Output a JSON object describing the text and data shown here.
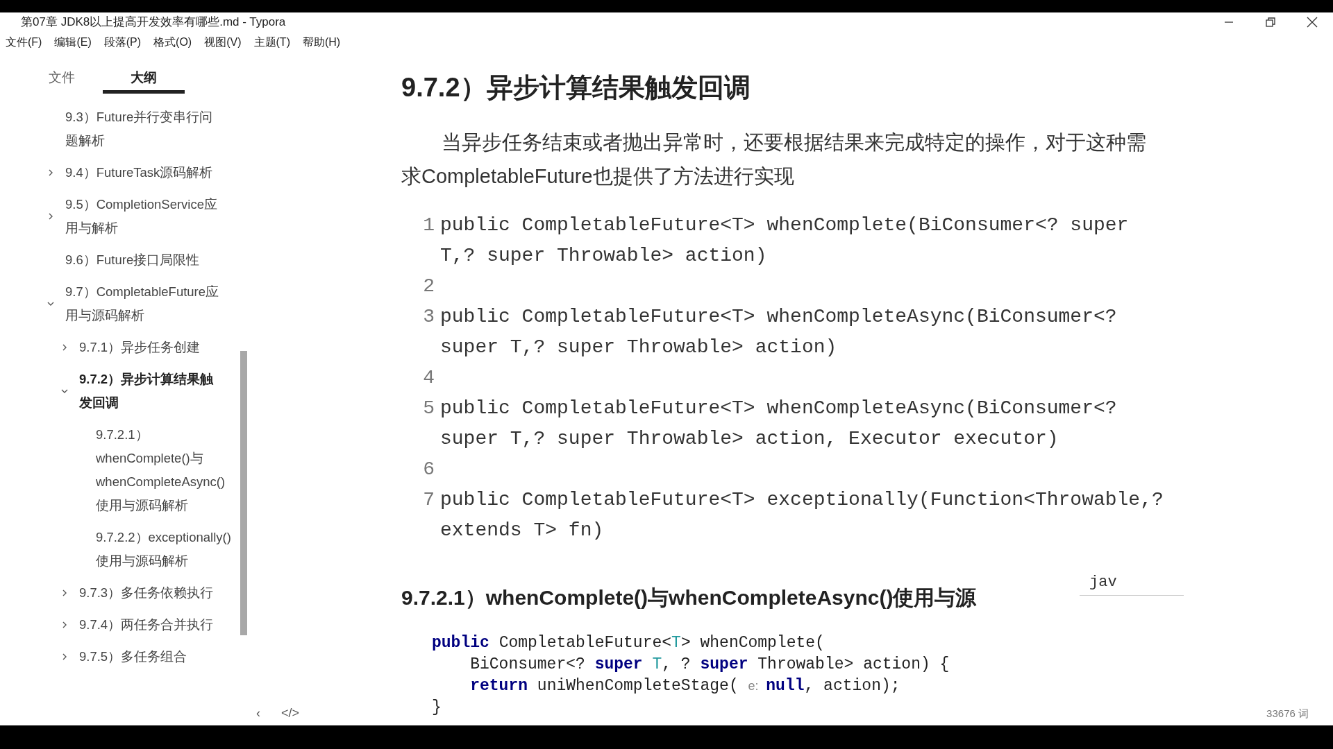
{
  "window": {
    "title": "第07章 JDK8以上提高开发效率有哪些.md - Typora"
  },
  "menu": [
    "文件(F)",
    "编辑(E)",
    "段落(P)",
    "格式(O)",
    "视图(V)",
    "主题(T)",
    "帮助(H)"
  ],
  "sidebar": {
    "tabs": [
      {
        "label": "文件",
        "selected": false
      },
      {
        "label": "大纲",
        "selected": true
      }
    ],
    "outline": [
      {
        "label": "9.3）Future并行变串行问题解析",
        "kind": "leaf",
        "selected": false
      },
      {
        "label": "9.4）FutureTask源码解析",
        "kind": "branch",
        "expanded": false,
        "selected": false
      },
      {
        "label": "9.5）CompletionService应用与解析",
        "kind": "branch",
        "expanded": false,
        "selected": false
      },
      {
        "label": "9.6）Future接口局限性",
        "kind": "leaf",
        "selected": false
      },
      {
        "label": "9.7）CompletableFuture应用与源码解析",
        "kind": "branch",
        "expanded": true,
        "selected": false,
        "children": [
          {
            "label": "9.7.1）异步任务创建",
            "kind": "branch",
            "expanded": false,
            "selected": false
          },
          {
            "label": "9.7.2）异步计算结果触发回调",
            "kind": "branch",
            "expanded": true,
            "selected": true,
            "children": [
              {
                "label": "9.7.2.1）whenComplete()与whenCompleteAsync()使用与源码解析",
                "kind": "leaf",
                "selected": false
              },
              {
                "label": "9.7.2.2）exceptionally()使用与源码解析",
                "kind": "leaf",
                "selected": false
              }
            ]
          },
          {
            "label": "9.7.3）多任务依赖执行",
            "kind": "branch",
            "expanded": false,
            "selected": false
          },
          {
            "label": "9.7.4）两任务合并执行",
            "kind": "branch",
            "expanded": false,
            "selected": false
          },
          {
            "label": "9.7.5）多任务组合",
            "kind": "branch",
            "expanded": false,
            "selected": false
          }
        ]
      }
    ],
    "footer": [
      "‹",
      "</>"
    ]
  },
  "document": {
    "heading": "9.7.2）异步计算结果触发回调",
    "paragraph": "当异步任务结束或者抛出异常时，还要根据结果来完成特定的操作，对于这种需求CompletableFuture也提供了方法进行实现",
    "code_block": [
      {
        "number": "1",
        "text": "public CompletableFuture<T> whenComplete(BiConsumer<? super T,? super Throwable> action)"
      },
      {
        "number": "2"
      },
      {
        "number": "3",
        "text": "public CompletableFuture<T> whenCompleteAsync(BiConsumer<? super T,? super Throwable> action)"
      },
      {
        "number": "4"
      },
      {
        "number": "5",
        "text": "public CompletableFuture<T> whenCompleteAsync(BiConsumer<? super T,? super Throwable> action, Executor executor)"
      },
      {
        "number": "6"
      },
      {
        "number": "7",
        "text": "public CompletableFuture<T> exceptionally(Function<Throwable,? extends T> fn)"
      }
    ],
    "subheading": "9.7.2.1）whenComplete()与whenCompleteAsync()使用与源",
    "language_input": {
      "value": "jav"
    },
    "source_code": [
      [
        {
          "kind": "kw",
          "text": "public"
        },
        {
          "kind": "plain",
          "text": " CompletableFuture<"
        },
        {
          "kind": "type",
          "text": "T"
        },
        {
          "kind": "plain",
          "text": "> whenComplete("
        }
      ],
      [
        {
          "kind": "indent"
        },
        {
          "kind": "plain",
          "text": "BiConsumer<? "
        },
        {
          "kind": "kw",
          "text": "super"
        },
        {
          "kind": "type",
          "text": " T"
        },
        {
          "kind": "plain",
          "text": ", ? "
        },
        {
          "kind": "kw",
          "text": "super"
        },
        {
          "kind": "plain",
          "text": " Throwable> action) {"
        }
      ],
      [
        {
          "kind": "indent"
        },
        {
          "kind": "kw",
          "text": "return"
        },
        {
          "kind": "plain",
          "text": " uniWhenCompleteStage( "
        },
        {
          "kind": "hint",
          "text": "e:"
        },
        {
          "kind": "kw",
          "text": "null"
        },
        {
          "kind": "plain",
          "text": ", action);"
        }
      ],
      [
        {
          "kind": "plain",
          "text": "}"
        }
      ]
    ],
    "word_count": "33676 词"
  }
}
